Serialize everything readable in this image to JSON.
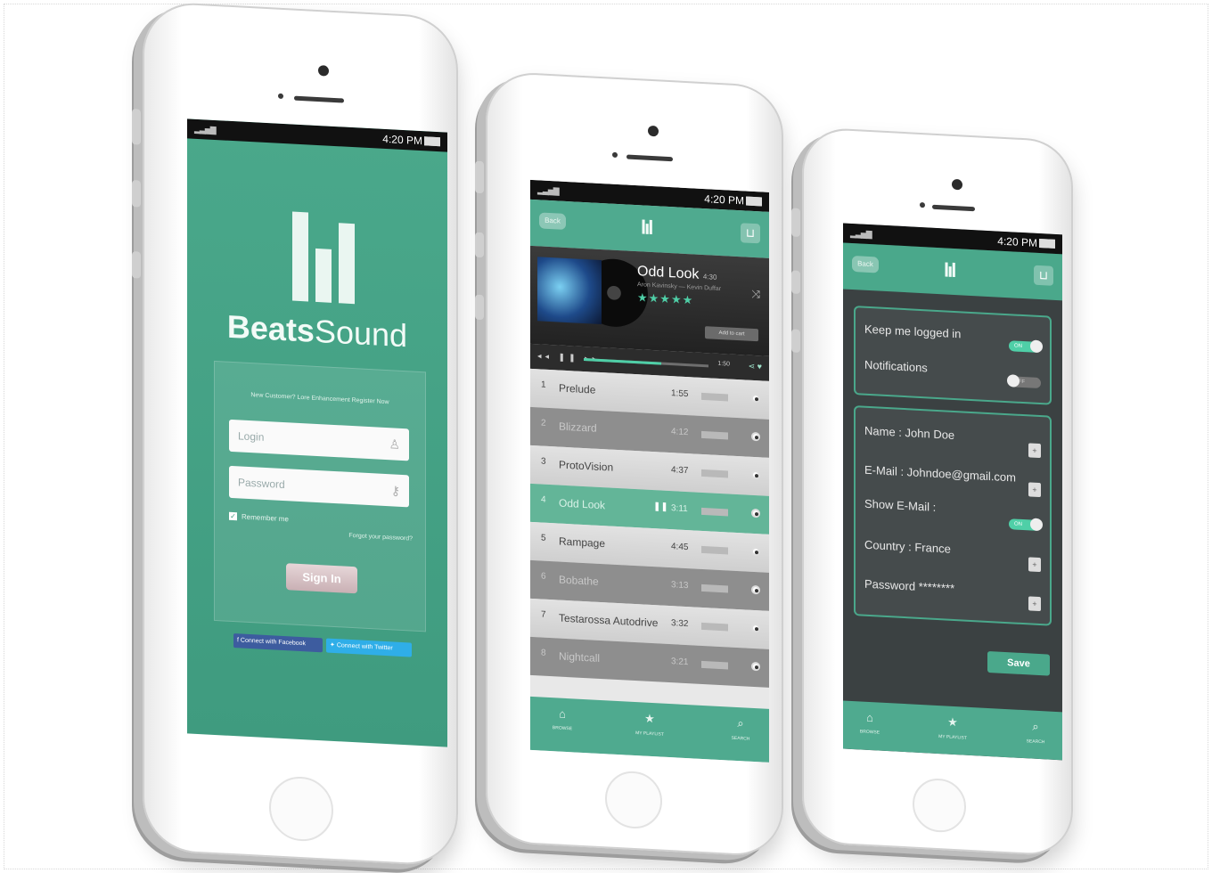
{
  "status": {
    "time": "4:20 PM",
    "signal": "▂▃▅▇"
  },
  "login": {
    "brand_bold": "Beats",
    "brand_regular": "Sound",
    "note": "New Customer? Lore Enhancement Register Now",
    "login_placeholder": "Login",
    "password_placeholder": "Password",
    "remember_label": "Remember me",
    "forgot_label": "Forgot your password?",
    "signin_label": "Sign In",
    "facebook_label": "Connect with Facebook",
    "twitter_label": "Connect with Twitter"
  },
  "player": {
    "back_label": "Back",
    "now_playing": {
      "title": "Odd Look",
      "duration": "4:30",
      "artists": "Aron Kavinsky — Kevin Duffar",
      "stars": "★★★★★",
      "add_to_cart": "Add to cart",
      "elapsed": "1:50"
    },
    "progress": 0.62,
    "tracks": [
      {
        "num": "1",
        "name": "Prelude",
        "duration": "1:55",
        "style": "light"
      },
      {
        "num": "2",
        "name": "Blizzard",
        "duration": "4:12",
        "style": "dark"
      },
      {
        "num": "3",
        "name": "ProtoVision",
        "duration": "4:37",
        "style": "light"
      },
      {
        "num": "4",
        "name": "Odd Look",
        "duration": "3:11",
        "style": "active"
      },
      {
        "num": "5",
        "name": "Rampage",
        "duration": "4:45",
        "style": "light"
      },
      {
        "num": "6",
        "name": "Bobathe",
        "duration": "3:13",
        "style": "dark"
      },
      {
        "num": "7",
        "name": "Testarossa Autodrive",
        "duration": "3:32",
        "style": "light"
      },
      {
        "num": "8",
        "name": "Nightcall",
        "duration": "3:21",
        "style": "dark"
      }
    ],
    "tabs": [
      {
        "icon": "⌂",
        "label": "BROWSE"
      },
      {
        "icon": "★",
        "label": "MY PLAYLIST"
      },
      {
        "icon": "⌕",
        "label": "SEARCH"
      }
    ]
  },
  "settings": {
    "back_label": "Back",
    "keep_logged": "Keep me logged in",
    "keep_logged_state": "ON",
    "notifications": "Notifications",
    "notifications_state": "OFF",
    "name": "Name : John Doe",
    "email": "E-Mail : Johndoe@gmail.com",
    "show_email": "Show E-Mail :",
    "show_email_state": "ON",
    "country": "Country : France",
    "password": "Password ********",
    "save_label": "Save"
  },
  "colors": {
    "accent": "#4aa88b",
    "accent_light": "#4fcfa7",
    "dark": "#3b4142"
  }
}
